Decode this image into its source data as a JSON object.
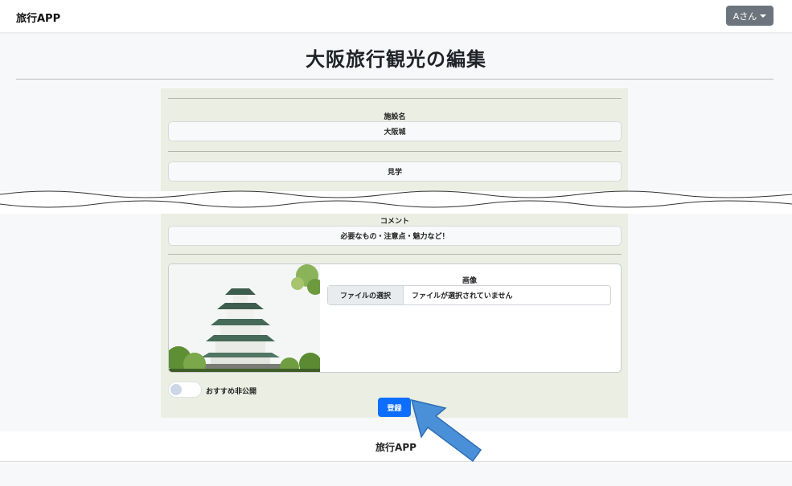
{
  "navbar": {
    "brand": "旅行APP",
    "user_menu": "Aさん"
  },
  "page": {
    "title": "大阪旅行観光の編集"
  },
  "form": {
    "facility_label": "施設名",
    "facility_value": "大阪城",
    "category_value": "見学",
    "comment_label": "コメント",
    "comment_placeholder": "必要なもの・注意点・魅力など！",
    "image_label": "画像",
    "file_button": "ファイルの選択",
    "file_status": "ファイルが選択されていません",
    "toggle_label": "おすすめ非公開",
    "submit_label": "登録"
  },
  "footer": {
    "text": "旅行APP"
  },
  "colors": {
    "panel": "#ebeee2",
    "primary": "#0d6efd",
    "user_button": "#6c757d",
    "pointer": "#4a90d9"
  }
}
